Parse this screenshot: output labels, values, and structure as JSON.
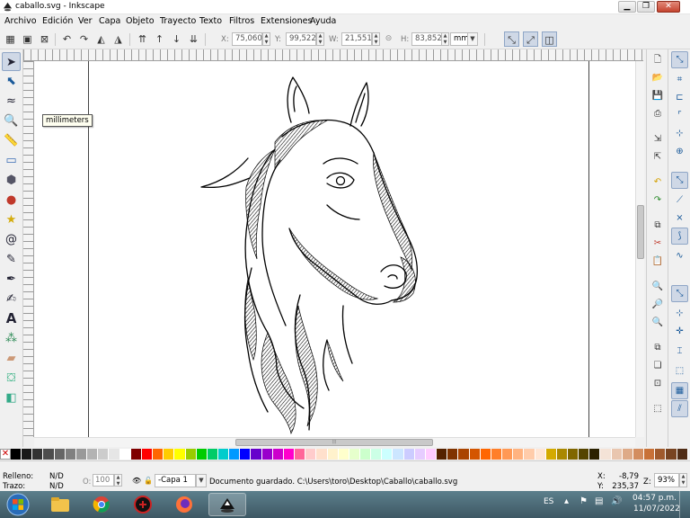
{
  "window": {
    "title": "caballo.svg - Inkscape",
    "controls": [
      "minimize",
      "maximize",
      "close"
    ]
  },
  "menu": [
    "Archivo",
    "Edición",
    "Ver",
    "Capa",
    "Objeto",
    "Trayecto",
    "Texto",
    "Filtros",
    "Extensiones",
    "Ayuda"
  ],
  "toolbar": {
    "x_label": "X:",
    "x_value": "75,060",
    "y_label": "Y:",
    "y_value": "99,522",
    "w_label": "W:",
    "w_value": "21,551",
    "h_label": "H:",
    "h_value": "83,852",
    "unit": "mm"
  },
  "tooltip": "millimeters",
  "left_tools": [
    "selector-icon",
    "node-icon",
    "tweak-icon",
    "zoom-icon",
    "measure-icon",
    "rect-icon",
    "box3d-icon",
    "ellipse-icon",
    "star-icon",
    "spiral-icon",
    "pencil-icon",
    "pen-icon",
    "calligraphy-icon",
    "text-icon",
    "spray-icon",
    "eraser-icon",
    "bucket-icon",
    "gradient-icon"
  ],
  "palette_colors": [
    "#000000",
    "#1a1a1a",
    "#333333",
    "#4d4d4d",
    "#666666",
    "#808080",
    "#999999",
    "#b3b3b3",
    "#cccccc",
    "#e6e6e6",
    "#ffffff",
    "#800000",
    "#ff0000",
    "#ff6600",
    "#ffcc00",
    "#ffff00",
    "#99cc00",
    "#00cc00",
    "#00cc66",
    "#00cccc",
    "#0099ff",
    "#0000ff",
    "#6600cc",
    "#9900cc",
    "#cc00cc",
    "#ff00cc",
    "#ff6699",
    "#ffcccc",
    "#ffe0cc",
    "#fff2cc",
    "#ffffcc",
    "#e6ffcc",
    "#ccffcc",
    "#ccffe6",
    "#ccffff",
    "#cce6ff",
    "#ccccff",
    "#e6ccff",
    "#ffccff",
    "#552200",
    "#803300",
    "#aa4400",
    "#d45500",
    "#ff6600",
    "#ff7f2a",
    "#ff9955",
    "#ffb380",
    "#ffccaa",
    "#ffe6d5",
    "#d4aa00",
    "#aa8800",
    "#806600",
    "#554400",
    "#2b2200",
    "#f4e3d7",
    "#e9c6af",
    "#deaa87",
    "#d38d5f",
    "#c87137",
    "#a05a2c",
    "#784421",
    "#502d16"
  ],
  "status": {
    "fill_label": "Relleno:",
    "fill_value": "N/D",
    "stroke_label": "Trazo:",
    "stroke_value": "N/D",
    "opacity_label": "O:",
    "opacity_value": "100",
    "layer": "-Capa 1",
    "message": "Documento guardado. C:\\Users\\toro\\Desktop\\Caballo\\caballo.svg",
    "cursor_x_label": "X:",
    "cursor_x": "-8,79",
    "cursor_y_label": "Y:",
    "cursor_y": "235,37",
    "zoom_label": "Z:",
    "zoom": "93%"
  },
  "taskbar": {
    "lang": "ES",
    "time": "04:57 p.m.",
    "date": "11/07/2022",
    "apps": [
      "start-orb-icon",
      "explorer-icon",
      "chrome-icon",
      "app-icon",
      "firefox-icon",
      "inkscape-icon"
    ]
  }
}
